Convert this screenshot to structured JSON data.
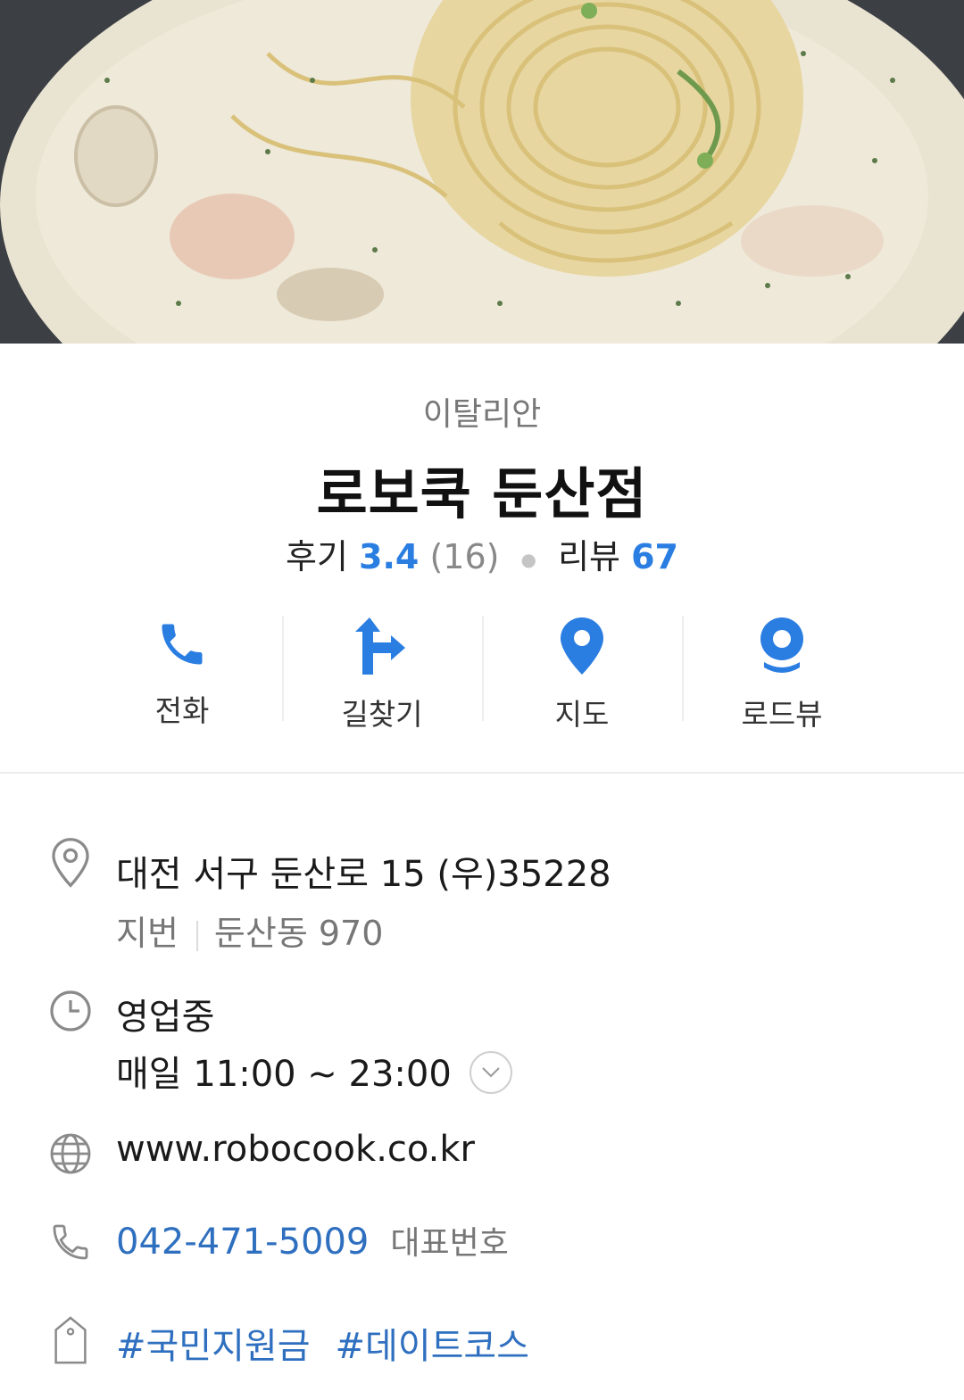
{
  "place": {
    "category": "이탈리안",
    "name": "로보쿡 둔산점",
    "review_label": "후기",
    "review_score": "3.4",
    "review_count": "(16)",
    "blog_label": "리뷰",
    "blog_count": "67"
  },
  "actions": {
    "call": "전화",
    "directions": "길찾기",
    "map": "지도",
    "roadview": "로드뷰"
  },
  "info": {
    "address": "대전 서구 둔산로 15 (우)35228",
    "jibun_label": "지번",
    "jibun_value": "둔산동 970",
    "status": "영업중",
    "hours": "매일 11:00 ~ 23:00",
    "website": "www.robocook.co.kr",
    "phone": "042-471-5009",
    "phone_note": "대표번호",
    "tags": [
      "#국민지원금",
      "#데이트코스"
    ]
  },
  "colors": {
    "accent_blue": "#2a7de1",
    "link_blue": "#2f6fbf",
    "open_green": "#3c9a5f"
  },
  "icons": [
    "phone-icon",
    "directions-icon",
    "map-pin-icon",
    "roadview-icon",
    "location-outline-icon",
    "clock-icon",
    "globe-icon",
    "phone-outline-icon",
    "tag-icon",
    "chevron-down-icon"
  ]
}
